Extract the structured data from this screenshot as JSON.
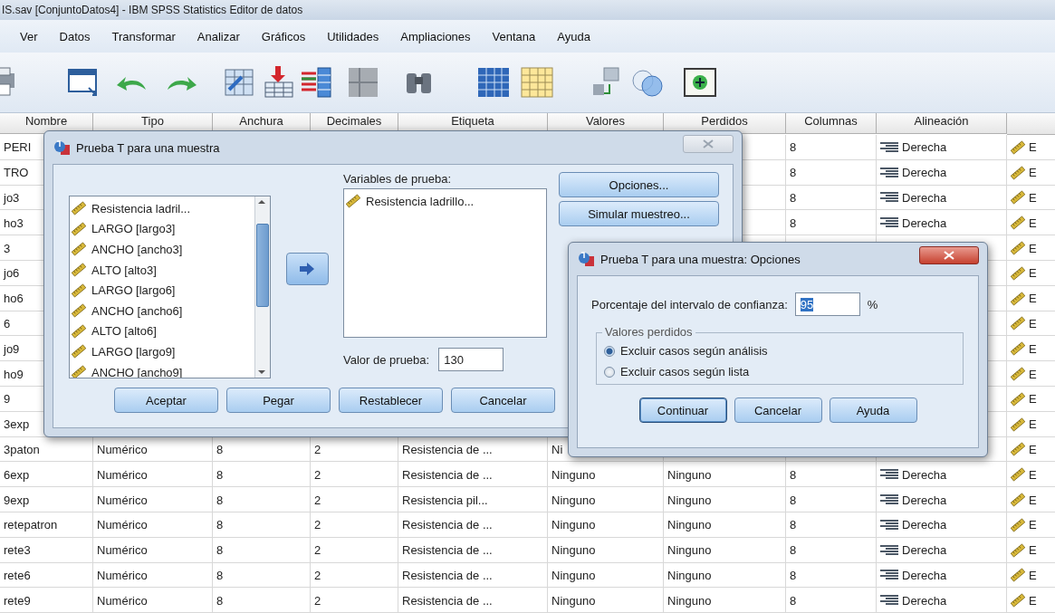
{
  "window": {
    "title": "IS.sav [ConjuntoDatos4] - IBM SPSS Statistics Editor de datos"
  },
  "menu": [
    "Ver",
    "Datos",
    "Transformar",
    "Analizar",
    "Gráficos",
    "Utilidades",
    "Ampliaciones",
    "Ventana",
    "Ayuda"
  ],
  "table": {
    "columns": [
      "Nombre",
      "Tipo",
      "Anchura",
      "Decimales",
      "Etiqueta",
      "Valores",
      "Perdidos",
      "Columnas",
      "Alineación"
    ],
    "rows": [
      {
        "nombre": "PERI",
        "columnas": "8",
        "alineacion": "Derecha",
        "medida": "E"
      },
      {
        "nombre": "TRO",
        "columnas": "8",
        "alineacion": "Derecha",
        "medida": "E"
      },
      {
        "nombre": "jo3",
        "columnas": "8",
        "alineacion": "Derecha",
        "medida": "E"
      },
      {
        "nombre": "ho3",
        "columnas": "8",
        "alineacion": "Derecha",
        "medida": "E"
      },
      {
        "nombre": "3",
        "medida": "E"
      },
      {
        "nombre": "jo6",
        "medida": "E"
      },
      {
        "nombre": "ho6",
        "medida": "E"
      },
      {
        "nombre": "6",
        "medida": "E"
      },
      {
        "nombre": "jo9",
        "medida": "E"
      },
      {
        "nombre": "ho9",
        "medida": "E"
      },
      {
        "nombre": "9",
        "medida": "E"
      },
      {
        "nombre": "3exp",
        "medida": "E"
      },
      {
        "nombre": "3paton",
        "tipo": "Numérico",
        "anchura": "8",
        "decimales": "2",
        "etiqueta": "Resistencia de ...",
        "valores": "Ni",
        "medida": "E"
      },
      {
        "nombre": "6exp",
        "tipo": "Numérico",
        "anchura": "8",
        "decimales": "2",
        "etiqueta": "Resistencia de ...",
        "valores": "Ninguno",
        "perdidos": "Ninguno",
        "columnas": "8",
        "alineacion": "Derecha",
        "medida": "E"
      },
      {
        "nombre": "9exp",
        "tipo": "Numérico",
        "anchura": "8",
        "decimales": "2",
        "etiqueta": "Resistencia pil...",
        "valores": "Ninguno",
        "perdidos": "Ninguno",
        "columnas": "8",
        "alineacion": "Derecha",
        "medida": "E"
      },
      {
        "nombre": "retepatron",
        "tipo": "Numérico",
        "anchura": "8",
        "decimales": "2",
        "etiqueta": "Resistencia de ...",
        "valores": "Ninguno",
        "perdidos": "Ninguno",
        "columnas": "8",
        "alineacion": "Derecha",
        "medida": "E"
      },
      {
        "nombre": "rete3",
        "tipo": "Numérico",
        "anchura": "8",
        "decimales": "2",
        "etiqueta": "Resistencia de ...",
        "valores": "Ninguno",
        "perdidos": "Ninguno",
        "columnas": "8",
        "alineacion": "Derecha",
        "medida": "E"
      },
      {
        "nombre": "rete6",
        "tipo": "Numérico",
        "anchura": "8",
        "decimales": "2",
        "etiqueta": "Resistencia de ...",
        "valores": "Ninguno",
        "perdidos": "Ninguno",
        "columnas": "8",
        "alineacion": "Derecha",
        "medida": "E"
      },
      {
        "nombre": "rete9",
        "tipo": "Numérico",
        "anchura": "8",
        "decimales": "2",
        "etiqueta": "Resistencia de ...",
        "valores": "Ninguno",
        "perdidos": "Ninguno",
        "columnas": "8",
        "alineacion": "Derecha",
        "medida": "E"
      }
    ]
  },
  "dialog": {
    "title": "Prueba T para una muestra",
    "source_items": [
      "Resistencia ladril...",
      "LARGO [largo3]",
      "ANCHO [ancho3]",
      "ALTO [alto3]",
      "LARGO [largo6]",
      "ANCHO [ancho6]",
      "ALTO [alto6]",
      "LARGO [largo9]",
      "ANCHO [ancho9]"
    ],
    "target_label": "Variables de prueba:",
    "target_items": [
      "Resistencia ladrillo..."
    ],
    "side_buttons": [
      "Opciones...",
      "Simular muestreo..."
    ],
    "test_value": {
      "label": "Valor de prueba:",
      "value": "130"
    },
    "buttons": [
      "Aceptar",
      "Pegar",
      "Restablecer",
      "Cancelar"
    ]
  },
  "options_dialog": {
    "title": "Prueba T para una muestra: Opciones",
    "confidence": {
      "label": "Porcentaje del intervalo de confianza:",
      "value": "95",
      "highlighted": true,
      "unit": "%"
    },
    "missing": {
      "legend": "Valores perdidos",
      "options": [
        {
          "label": "Excluir casos según análisis",
          "selected": true
        },
        {
          "label": "Excluir casos según lista",
          "selected": false
        }
      ]
    },
    "buttons": [
      {
        "label": "Continuar",
        "focused": true
      },
      {
        "label": "Cancelar",
        "focused": false
      },
      {
        "label": "Ayuda",
        "focused": false
      }
    ]
  }
}
